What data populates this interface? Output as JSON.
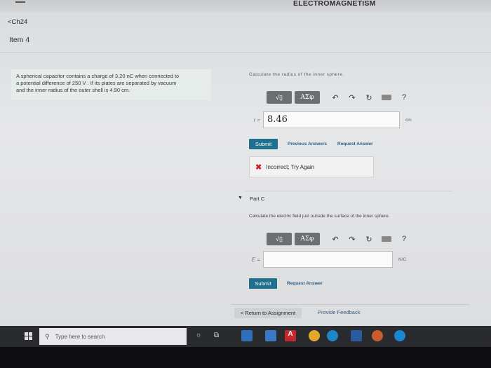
{
  "header": {
    "app_title": "ELECTROMAGNETISM",
    "chapter_link": "<Ch24",
    "item_title": "Item 4"
  },
  "problem": {
    "line1": "A spherical capacitor contains a charge of 3.20 nC when connected to",
    "line2": "a potential difference of 250 V . If its plates are separated by vacuum",
    "line3": "and the inner radius of the outer shell is 4.90 cm."
  },
  "partb": {
    "cutoff_question": "Calculate the radius of the inner sphere.",
    "toolbar": {
      "sqrt_label": "√▯",
      "greek_label": "ΑΣφ",
      "undo": "↶",
      "redo": "↷",
      "reset": "↻",
      "help": "?"
    },
    "answer_label": "r =",
    "answer_value": "8.46",
    "unit": "cm",
    "submit_label": "Submit",
    "previous_answers": "Previous Answers",
    "request_answer": "Request Answer",
    "feedback_icon": "✖",
    "feedback_message": "Incorrect; Try Again"
  },
  "partc": {
    "title": "Part C",
    "question": "Calculate the electric field just outside the surface of the inner sphere.",
    "toolbar": {
      "sqrt_label": "√▯",
      "greek_label": "ΑΣφ",
      "undo": "↶",
      "redo": "↷",
      "reset": "↻",
      "help": "?"
    },
    "answer_label": "E =",
    "answer_value": "",
    "unit": "N/C",
    "submit_label": "Submit",
    "request_answer": "Request Answer"
  },
  "footer": {
    "return_label": "< Return to Assignment",
    "provide_feedback": "Provide Feedback"
  },
  "taskbar": {
    "search_placeholder": "Type here to search"
  }
}
